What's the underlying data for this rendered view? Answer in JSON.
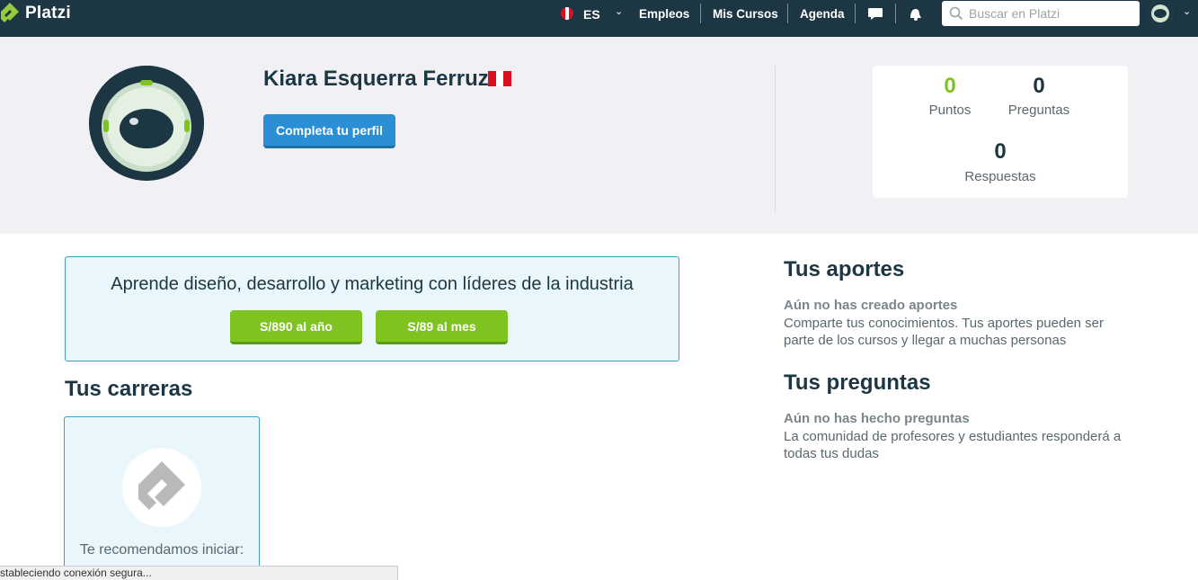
{
  "navbar": {
    "brand": "Platzi",
    "lang": "ES",
    "links": [
      "Empleos",
      "Mis Cursos",
      "Agenda"
    ],
    "search_placeholder": "Buscar en Platzi",
    "icons": [
      "chat-bubble-icon",
      "notifications-icon",
      "search-icon",
      "chevron-down-icon"
    ]
  },
  "profile": {
    "name": "Kiara Esquerra Ferruzo",
    "complete_button": "Completa tu perfil",
    "flag_colors": [
      "#d91023",
      "#ffffff",
      "#d91023"
    ]
  },
  "stats": {
    "points_value": "0",
    "points_label": "Puntos",
    "questions_value": "0",
    "questions_label": "Preguntas",
    "answers_value": "0",
    "answers_label": "Respuestas"
  },
  "promo": {
    "text": "Aprende diseño, desarrollo y marketing con líderes de la industria",
    "yearly_button": "S/890 al año",
    "monthly_button": "S/89 al mes"
  },
  "careers": {
    "title": "Tus carreras",
    "recommend_text": "Te recomendamos iniciar:"
  },
  "contributions": {
    "title": "Tus aportes",
    "empty_title": "Aún no has creado aportes",
    "empty_desc": "Comparte tus conocimientos. Tus aportes pueden ser parte de los cursos y llegar a muchas personas"
  },
  "questions": {
    "title": "Tus preguntas",
    "empty_title": "Aún no has hecho preguntas",
    "empty_desc": "La comunidad de profesores y estudiantes responderá a todas tus dudas"
  },
  "status_bar": {
    "text": "stableciendo conexión segura..."
  },
  "colors": {
    "navbar_bg": "#1c3643",
    "accent_green": "#7ec320",
    "accent_blue": "#2b8fd6"
  }
}
